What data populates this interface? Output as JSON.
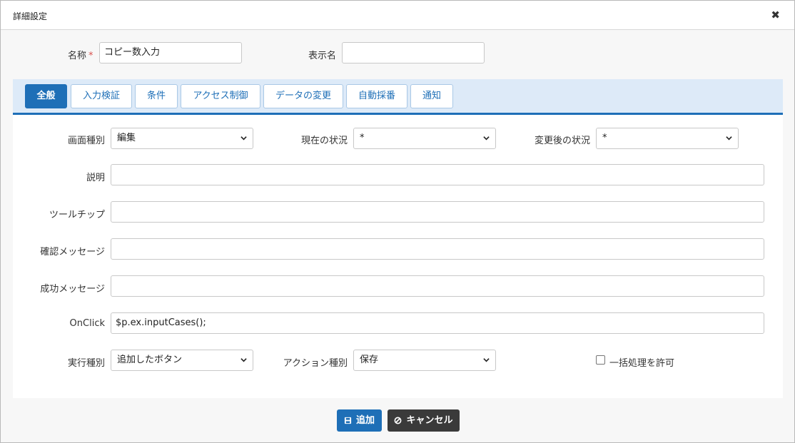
{
  "dialog": {
    "title": "詳細設定",
    "close_glyph": "✖"
  },
  "header_fields": {
    "name_label": "名称",
    "required_mark": "*",
    "name_value": "コピー数入力",
    "display_name_label": "表示名",
    "display_name_value": ""
  },
  "tabs": [
    {
      "label": "全般",
      "active": true
    },
    {
      "label": "入力検証",
      "active": false
    },
    {
      "label": "条件",
      "active": false
    },
    {
      "label": "アクセス制御",
      "active": false
    },
    {
      "label": "データの変更",
      "active": false
    },
    {
      "label": "自動採番",
      "active": false
    },
    {
      "label": "通知",
      "active": false
    }
  ],
  "general": {
    "screen_type_label": "画面種別",
    "screen_type_value": "編集",
    "current_status_label": "現在の状況",
    "current_status_value": "*",
    "changed_status_label": "変更後の状況",
    "changed_status_value": "*",
    "description_label": "説明",
    "description_value": "",
    "tooltip_label": "ツールチップ",
    "tooltip_value": "",
    "confirm_message_label": "確認メッセージ",
    "confirm_message_value": "",
    "success_message_label": "成功メッセージ",
    "success_message_value": "",
    "onclick_label": "OnClick",
    "onclick_value": "$p.ex.inputCases();",
    "exec_type_label": "実行種別",
    "exec_type_value": "追加したボタン",
    "action_type_label": "アクション種別",
    "action_type_value": "保存",
    "bulk_label": "一括処理を許可",
    "bulk_checked": false
  },
  "footer": {
    "add_label": "追加",
    "cancel_label": "キャンセル"
  },
  "colors": {
    "accent": "#1e6fb7",
    "tabbar_bg": "#ddeaf8",
    "required": "#d9534f",
    "cancel_bg": "#3a3a3a"
  },
  "icons": {
    "close": "close-icon",
    "save": "save-icon",
    "cancel": "cancel-icon",
    "dropdown": "chevron-down-icon"
  }
}
